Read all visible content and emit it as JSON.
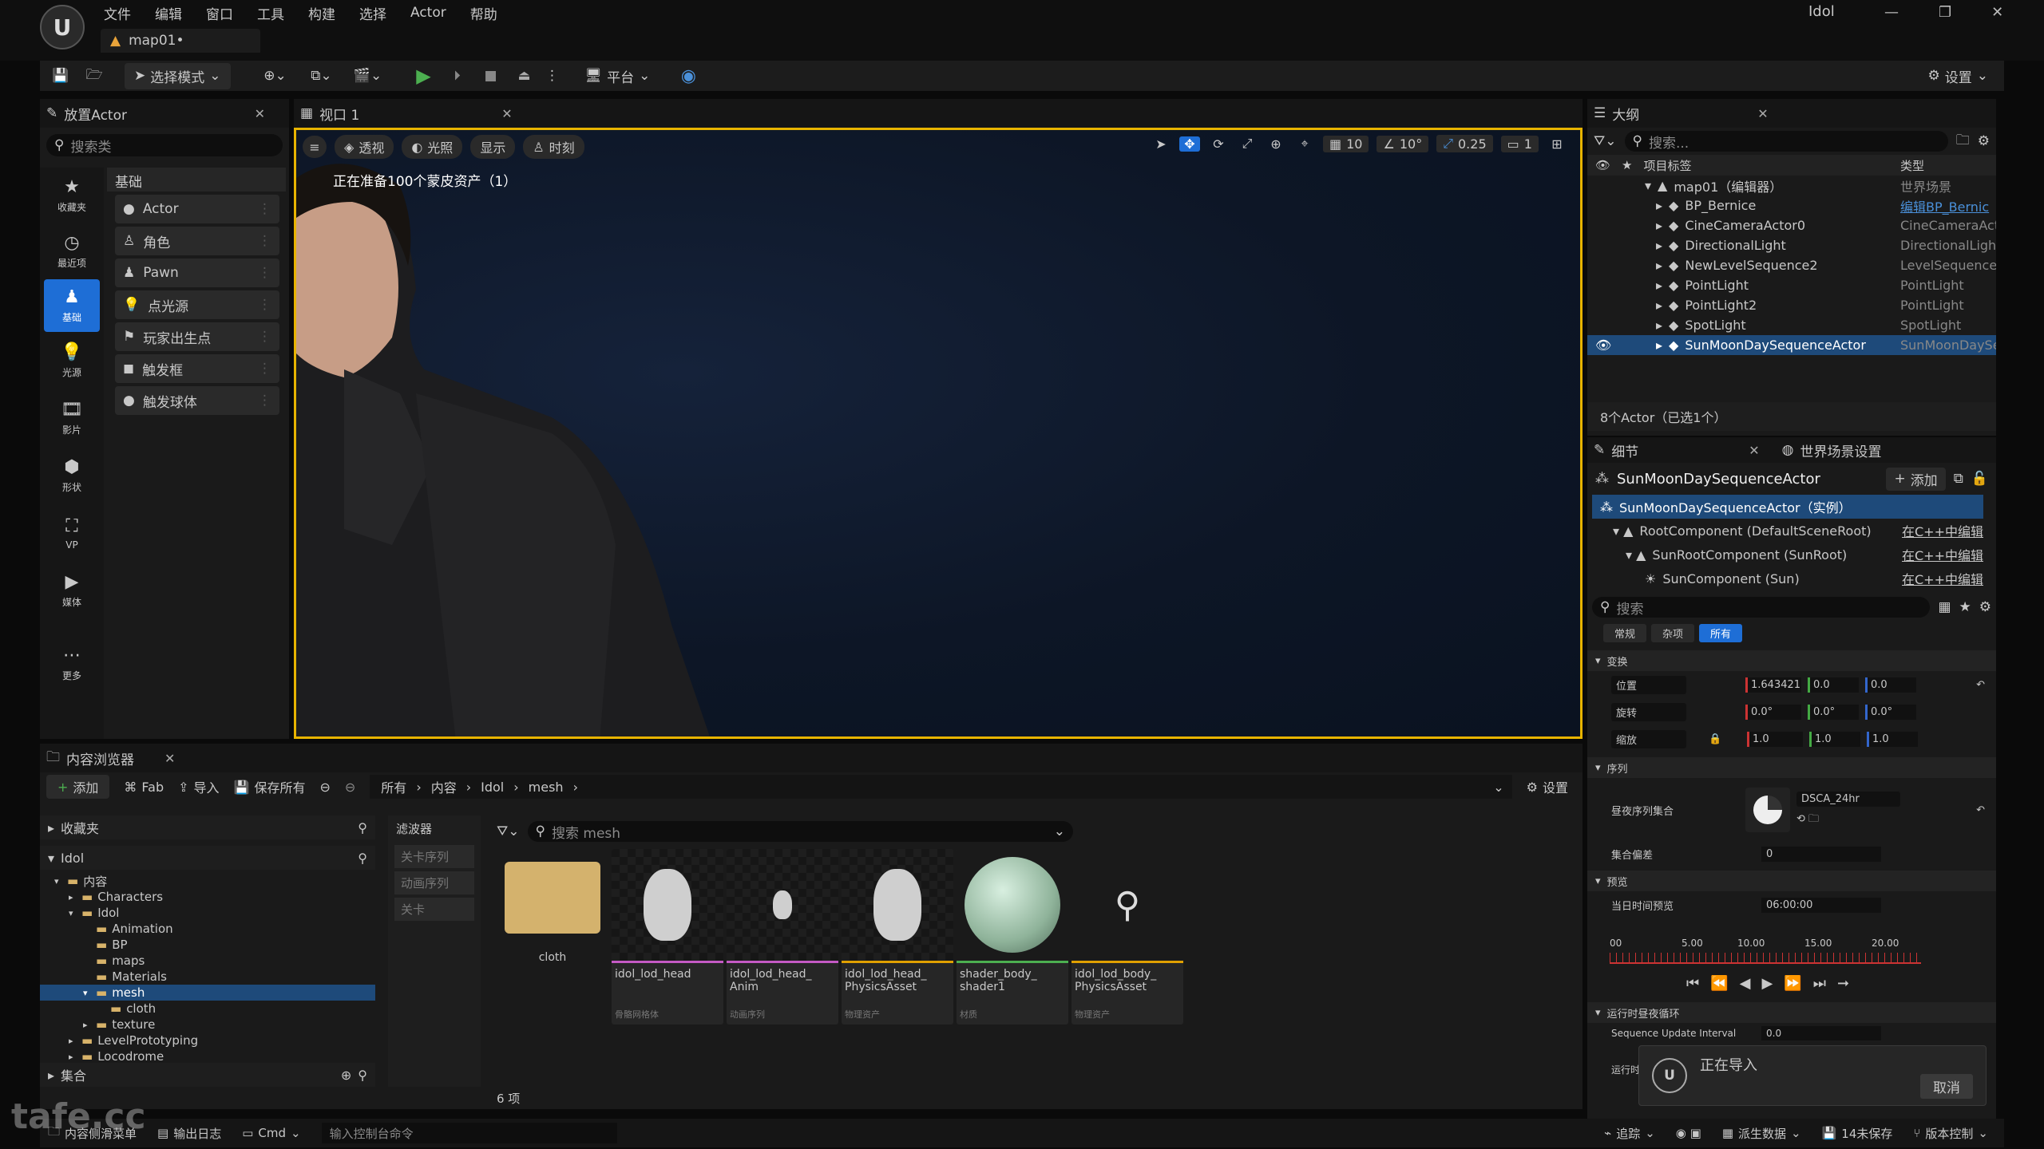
{
  "menu": {
    "items": [
      "文件",
      "编辑",
      "窗口",
      "工具",
      "构建",
      "选择",
      "Actor",
      "帮助"
    ],
    "project": "Idol",
    "tab": "map01•"
  },
  "toolbar": {
    "select_mode": "选择模式",
    "platform": "平台",
    "settings": "设置"
  },
  "place": {
    "tab": "放置Actor",
    "search_placeholder": "搜索类",
    "category": "基础",
    "cats": [
      "收藏夹",
      "最近项",
      "基础",
      "光源",
      "影片",
      "形状",
      "VP",
      "媒体",
      "更多"
    ],
    "items": [
      "Actor",
      "角色",
      "Pawn",
      "点光源",
      "玩家出生点",
      "触发框",
      "触发球体"
    ]
  },
  "viewport": {
    "tab": "视口 1",
    "perspective": "透视",
    "lit": "光照",
    "show": "显示",
    "time": "时刻",
    "grid": "10",
    "angle": "10°",
    "scale": "0.25",
    "cam": "1",
    "status": "正在准备100个蒙皮资产（1）"
  },
  "outliner": {
    "tab": "大纲",
    "search_placeholder": "搜索...",
    "col_label": "项目标签",
    "col_type": "类型",
    "root": {
      "label": "map01（编辑器）",
      "type": "世界场景"
    },
    "items": [
      {
        "label": "BP_Bernice",
        "type": "编辑BP_Bernic"
      },
      {
        "label": "CineCameraActor0",
        "type": "CineCameraAct"
      },
      {
        "label": "DirectionalLight",
        "type": "DirectionalLight"
      },
      {
        "label": "NewLevelSequence2",
        "type": "LevelSequence"
      },
      {
        "label": "PointLight",
        "type": "PointLight"
      },
      {
        "label": "PointLight2",
        "type": "PointLight"
      },
      {
        "label": "SpotLight",
        "type": "SpotLight"
      },
      {
        "label": "SunMoonDaySequenceActor",
        "type": "SunMoonDaySe"
      }
    ],
    "footer": "8个Actor（已选1个）"
  },
  "details": {
    "tab": "细节",
    "tab2": "世界场景设置",
    "actor": "SunMoonDaySequenceActor",
    "add": "添加",
    "components": [
      {
        "label": "SunMoonDaySequenceActor（实例）",
        "edit": ""
      },
      {
        "label": "RootComponent (DefaultSceneRoot)",
        "edit": "在C++中编辑"
      },
      {
        "label": "SunRootComponent (SunRoot)",
        "edit": "在C++中编辑"
      },
      {
        "label": "SunComponent (Sun)",
        "edit": "在C++中编辑"
      }
    ],
    "search_placeholder": "搜索",
    "filters": [
      "常规",
      "杂项",
      "所有"
    ],
    "transform": "变换",
    "location": "位置",
    "rotation": "旋转",
    "scale": "缩放",
    "loc": [
      "1.643421",
      "0.0",
      "0.0"
    ],
    "rot": [
      "0.0°",
      "0.0°",
      "0.0°"
    ],
    "scl": [
      "1.0",
      "1.0",
      "1.0"
    ],
    "sequence": "序列",
    "day_seq_set": "昼夜序列集合",
    "dsca": "DSCA_24hr",
    "offset_label": "集合偏差",
    "offset": "0",
    "preview": "预览",
    "tod_label": "当日时间预览",
    "tod": "06:00:00",
    "ticks": [
      "00",
      "5.00",
      "10.00",
      "15.00",
      "20.00"
    ],
    "runtime": "运行时昼夜循环",
    "seq_interval": "Sequence Update Interval",
    "seq_interval_val": "0.0",
    "run_label": "运行时"
  },
  "content": {
    "tab": "内容浏览器",
    "add": "添加",
    "fab": "Fab",
    "import": "导入",
    "save_all": "保存所有",
    "crumbs": [
      "所有",
      "内容",
      "Idol",
      "mesh"
    ],
    "settings": "设置",
    "favorites": "收藏夹",
    "project": "Idol",
    "tree": [
      "内容",
      "Characters",
      "Idol",
      "Animation",
      "BP",
      "maps",
      "Materials",
      "mesh",
      "cloth",
      "texture",
      "LevelPrototyping",
      "Locodrome"
    ],
    "collections": "集合",
    "filters_title": "滤波器",
    "filters": [
      "关卡序列",
      "动画序列",
      "关卡"
    ],
    "search_placeholder": "搜索 mesh",
    "count": "6 项",
    "assets": [
      {
        "name": "cloth",
        "type": ""
      },
      {
        "name": "idol_lod_head",
        "type": "骨骼网格体"
      },
      {
        "name": "idol_lod_head_\nAnim",
        "type": "动画序列"
      },
      {
        "name": "idol_lod_head_\nPhysicsAsset",
        "type": "物理资产"
      },
      {
        "name": "shader_body_\nshader1",
        "type": "材质"
      },
      {
        "name": "idol_lod_body_\nPhysicsAsset",
        "type": "物理资产"
      }
    ]
  },
  "status": {
    "drawer": "内容侧滑菜单",
    "log": "输出日志",
    "cmd": "Cmd",
    "cmd_placeholder": "输入控制台命令",
    "trace": "追踪",
    "derived": "派生数据",
    "unsaved": "14未保存",
    "vcs": "版本控制"
  },
  "toast": {
    "title": "正在导入",
    "cancel": "取消"
  },
  "watermark": "tafe.cc"
}
